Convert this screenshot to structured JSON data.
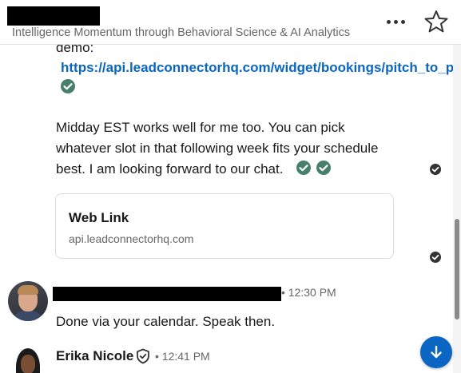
{
  "header": {
    "subtitle": "Intelligence Momentum through Behavioral Science & AI Analytics",
    "more_icon": "more-horizontal-icon",
    "star_icon": "star-outline-icon"
  },
  "thread": {
    "message1": {
      "demo_text": "demo:",
      "link": "https://api.leadconnectorhq.com/widget/bookings/pitch_to_p",
      "body_lines": [
        "Midday EST works well for me too. You can pick",
        "whatever slot in that following week fits your schedule",
        "best. I am looking forward to our chat."
      ],
      "link_card": {
        "title": "Web Link",
        "domain": "api.leadconnectorhq.com"
      }
    },
    "message2": {
      "meta": "• 12:30 PM",
      "text": "Done via your calendar. Speak then."
    },
    "message3": {
      "sender": "Erika Nicole",
      "meta": "• 12:41 PM"
    }
  },
  "colors": {
    "accent": "#0a66c2",
    "check_green": "#477f6d",
    "text": "#191919",
    "muted": "#666666"
  }
}
